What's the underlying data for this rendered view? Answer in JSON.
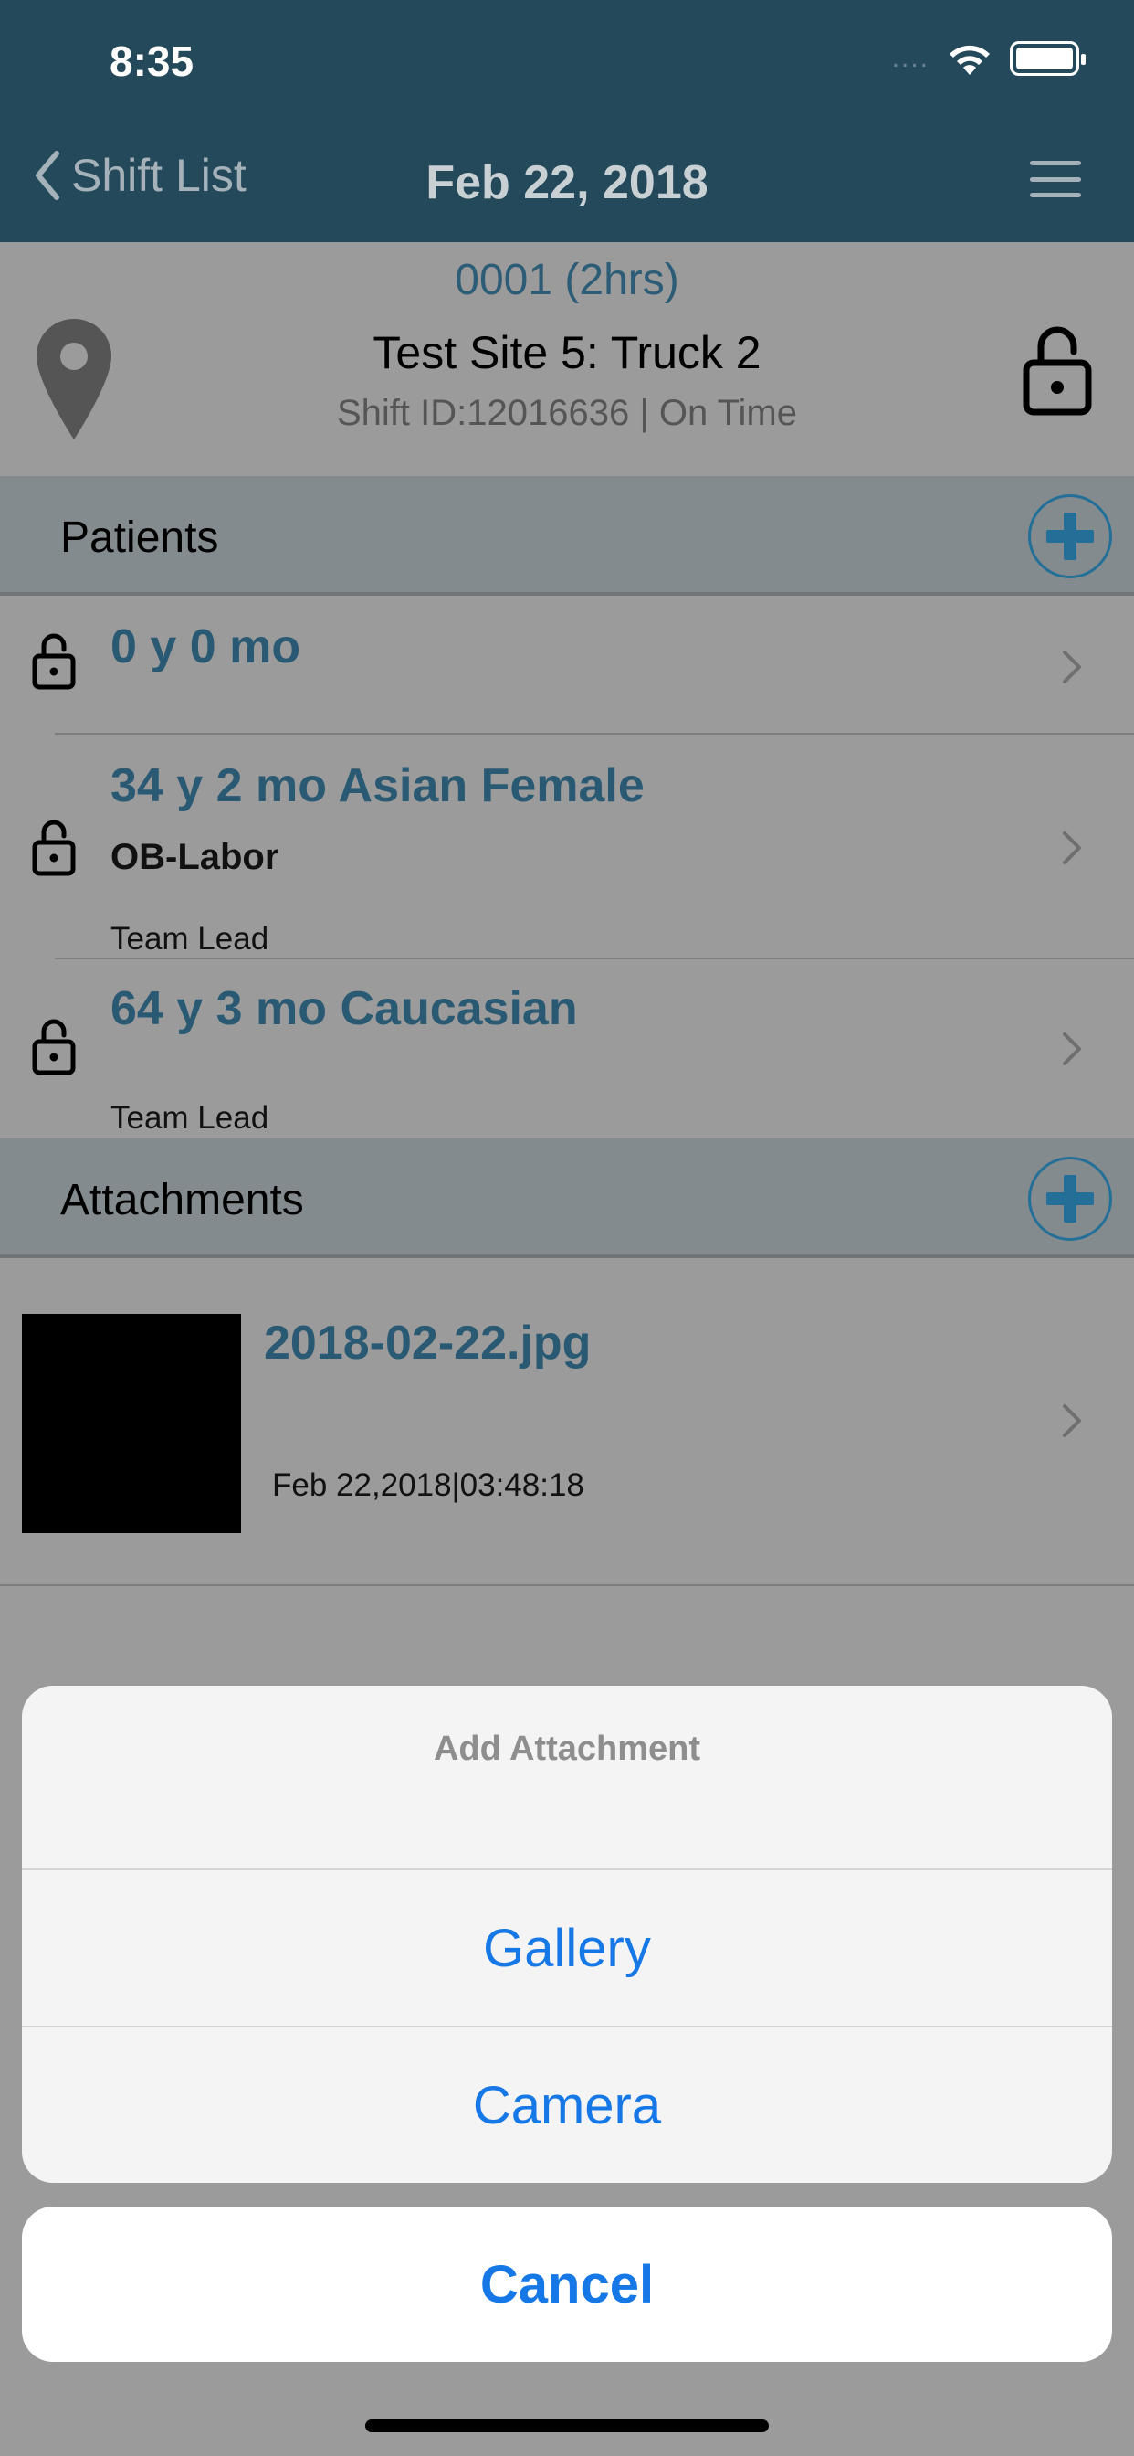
{
  "status_bar": {
    "time": "8:35",
    "signal": "....",
    "wifi_icon": "wifi-icon",
    "battery_icon": "battery-icon"
  },
  "nav": {
    "back_label": "Shift List",
    "title": "Feb 22, 2018",
    "menu_icon": "hamburger-icon"
  },
  "shift": {
    "code": "0001 (2hrs)",
    "site": "Test Site 5: Truck 2",
    "meta": "Shift ID:12016636 | On Time"
  },
  "patients_section": {
    "title": "Patients"
  },
  "patients": [
    {
      "title": "0 y 0 mo",
      "subtitle": "",
      "role": ""
    },
    {
      "title": "34 y 2 mo  Asian Female",
      "subtitle": "OB-Labor",
      "role": "Team Lead"
    },
    {
      "title": "64 y 3 mo  Caucasian",
      "subtitle": "",
      "role": "Team Lead"
    }
  ],
  "attachments_section": {
    "title": "Attachments"
  },
  "attachments": [
    {
      "name": "2018-02-22.jpg",
      "date": "Feb 22,2018|03:48:18"
    }
  ],
  "action_sheet": {
    "title": "Add Attachment",
    "options": [
      "Gallery",
      "Camera"
    ],
    "cancel": "Cancel"
  },
  "colors": {
    "header": "#24495b",
    "accent": "#2a5a73",
    "action": "#1578e6"
  }
}
